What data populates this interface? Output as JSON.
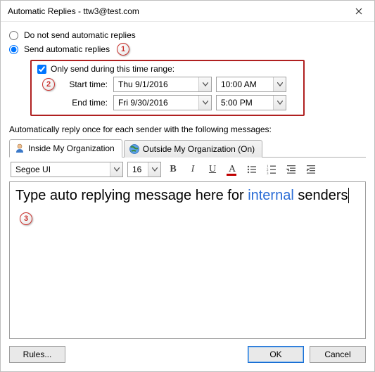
{
  "window": {
    "title": "Automatic Replies - ttw3@test.com"
  },
  "options": {
    "do_not_send": "Do not send automatic replies",
    "send": "Send automatic replies"
  },
  "time_range": {
    "checkbox_label": "Only send during this time range:",
    "start_label": "Start time:",
    "end_label": "End time:",
    "start_date": "Thu 9/1/2016",
    "start_time": "10:00 AM",
    "end_date": "Fri 9/30/2016",
    "end_time": "5:00 PM"
  },
  "instruction": "Automatically reply once for each sender with the following messages:",
  "tabs": {
    "inside": "Inside My Organization",
    "outside": "Outside My Organization (On)"
  },
  "toolbar": {
    "font": "Segoe UI",
    "size": "16"
  },
  "editor": {
    "prefix": "Type auto replying message here for ",
    "internal_word": "internal",
    "suffix": " senders"
  },
  "buttons": {
    "rules": "Rules...",
    "ok": "OK",
    "cancel": "Cancel"
  },
  "annotations": {
    "a1": "1",
    "a2": "2",
    "a3": "3"
  }
}
